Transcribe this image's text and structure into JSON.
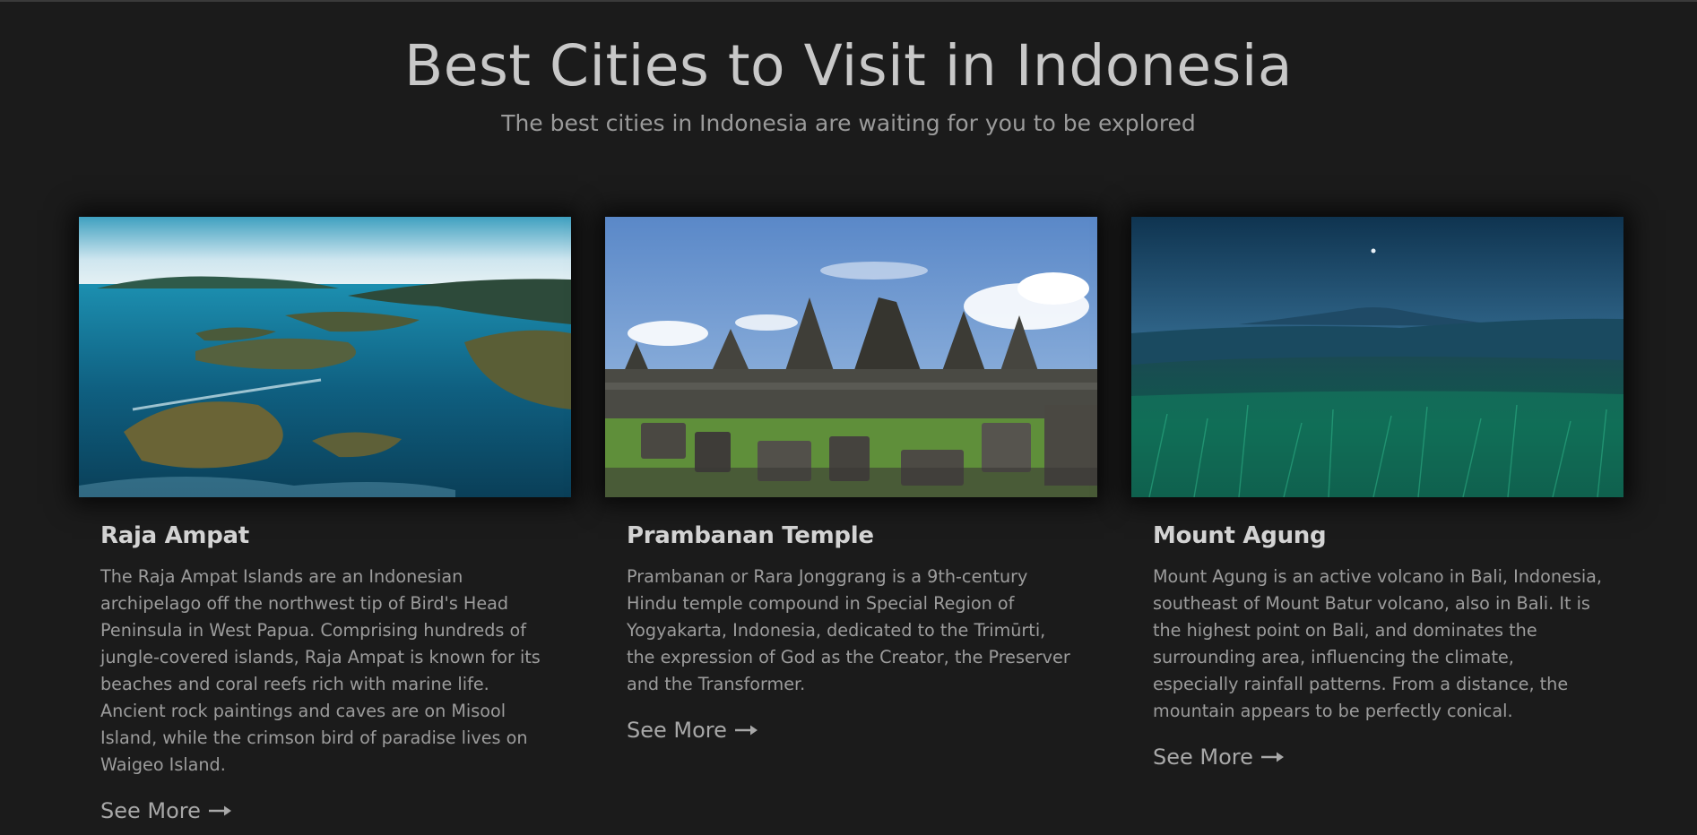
{
  "header": {
    "title": "Best Cities to Visit in Indonesia",
    "subtitle": "The best cities in Indonesia are waiting for you to be explored"
  },
  "cards": [
    {
      "title": "Raja Ampat",
      "image": "raja-ampat-islands-photo",
      "text": "The Raja Ampat Islands are an Indonesian archipelago off the northwest tip of Bird's Head Peninsula in West Papua. Comprising hundreds of jungle-covered islands, Raja Ampat is known for its beaches and coral reefs rich with marine life. Ancient rock paintings and caves are on Misool Island, while the crimson bird of paradise lives on Waigeo Island.",
      "link": "See More"
    },
    {
      "title": "Prambanan Temple",
      "image": "prambanan-temple-photo",
      "text": "Prambanan or Rara Jonggrang is a 9th-century Hindu temple compound in Special Region of Yogyakarta, Indonesia, dedicated to the Trimūrti, the expression of God as the Creator, the Preserver and the Transformer.",
      "link": "See More"
    },
    {
      "title": "Mount Agung",
      "image": "mount-agung-photo",
      "text": "Mount Agung is an active volcano in Bali, Indonesia, southeast of Mount Batur volcano, also in Bali. It is the highest point on Bali, and dominates the surrounding area, influencing the climate, especially rainfall patterns. From a distance, the mountain appears to be perfectly conical.",
      "link": "See More"
    }
  ],
  "colors": {
    "background": "#1b1b1b",
    "title": "#c8c8c8",
    "text": "#9c9c9c"
  }
}
